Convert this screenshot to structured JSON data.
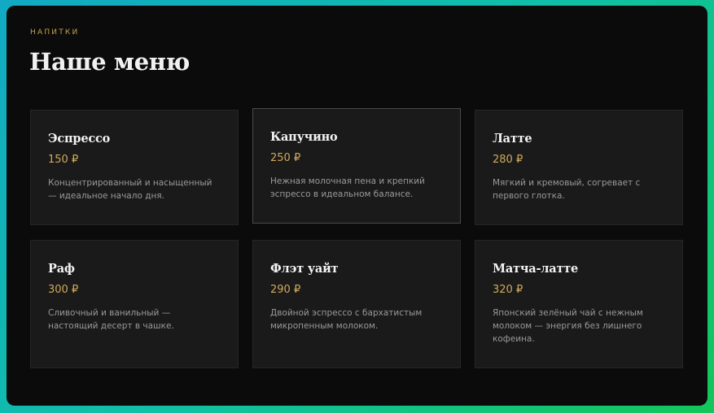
{
  "section": {
    "eyebrow": "НАПИТКИ",
    "title": "Наше меню"
  },
  "menu": {
    "items": [
      {
        "name": "Эспрессо",
        "price": "150 ₽",
        "description": "Концентрированный и насыщенный — идеальное начало дня."
      },
      {
        "name": "Капучино",
        "price": "250 ₽",
        "description": "Нежная молочная пена и крепкий эспрессо в идеальном балансе."
      },
      {
        "name": "Латте",
        "price": "280 ₽",
        "description": "Мягкий и кремовый, согревает с первого глотка."
      },
      {
        "name": "Раф",
        "price": "300 ₽",
        "description": "Сливочный и ванильный — настоящий десерт в чашке."
      },
      {
        "name": "Флэт уайт",
        "price": "290 ₽",
        "description": "Двойной эспрессо с бархатистым микропенным молоком."
      },
      {
        "name": "Матча-латте",
        "price": "320 ₽",
        "description": "Японский зелёный чай с нежным молоком — энергия без лишнего кофеина."
      }
    ]
  },
  "colors": {
    "accent": "#c9a24a",
    "background": "#0b0b0b",
    "card": "#1a1a1a",
    "frame_gradient": [
      "#12a9c4",
      "#12c65a"
    ]
  }
}
